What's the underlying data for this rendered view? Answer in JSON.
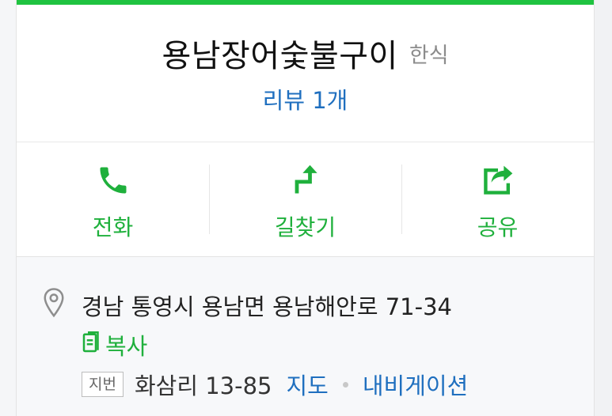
{
  "place": {
    "name": "용남장어숯불구이",
    "category": "한식",
    "review_label": "리뷰 1개"
  },
  "actions": [
    {
      "label": "전화",
      "icon": "phone-icon"
    },
    {
      "label": "길찾기",
      "icon": "directions-icon"
    },
    {
      "label": "공유",
      "icon": "share-icon"
    }
  ],
  "info": {
    "road_address": "경남 통영시 용남면 용남해안로 71-34",
    "copy_label": "복사",
    "jibun_badge": "지번",
    "jibun_address": "화삼리 13-85",
    "map_link": "지도",
    "navigation_link": "내비게이션"
  },
  "colors": {
    "accent_green": "#1fc340",
    "action_green": "#1fb03c",
    "link_blue": "#1f6fbf"
  }
}
